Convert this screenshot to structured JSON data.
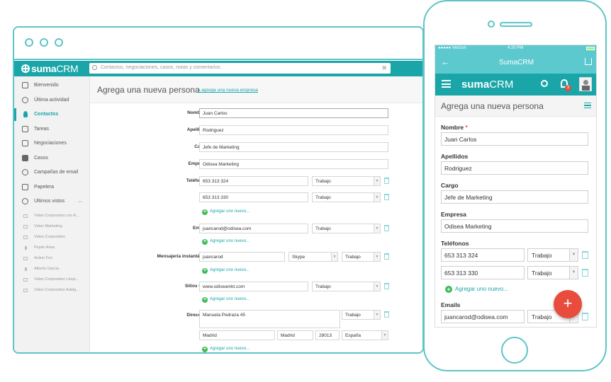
{
  "desktop": {
    "brand": {
      "name": "suma",
      "suffix": "CRM"
    },
    "search": {
      "placeholder": "Contactos, negociaciones, casos, notas y comentarios"
    },
    "sidebar": {
      "items": [
        {
          "label": "Bienvenido",
          "icon": "home-icon"
        },
        {
          "label": "Última actividad",
          "icon": "history-icon"
        },
        {
          "label": "Contactos",
          "icon": "person-icon",
          "active": true
        },
        {
          "label": "Tareas",
          "icon": "checkbox-icon"
        },
        {
          "label": "Negociaciones",
          "icon": "money-icon"
        },
        {
          "label": "Casos",
          "icon": "briefcase-icon"
        },
        {
          "label": "Campañas de email",
          "icon": "at-icon"
        },
        {
          "label": "Papelera",
          "icon": "trash-icon"
        },
        {
          "label": "Ultimos vistos",
          "icon": "clock-icon"
        }
      ],
      "recent": [
        "Video Corporativo con A...",
        "Video Marketing",
        "Video Corporativo",
        "Pepito Arias",
        "Action Fun",
        "Alberto Garcia",
        "Video Corporativo Limpi...",
        "Video Corporativo Adelg..."
      ]
    },
    "form": {
      "title": "Agrega una nueva persona",
      "alt_link": "o agrega una nueva empresa",
      "labels": {
        "nombre": "Nombre",
        "apellidos": "Apellidos",
        "cargo": "Cargo",
        "empresa": "Empresa",
        "telefonos": "Teléfonos",
        "emails": "Emails",
        "mensajeria": "Mensajería instantánea",
        "sitios": "Sitios web",
        "direccion": "Dirección"
      },
      "required_mark": "*",
      "values": {
        "nombre": "Juan Carlos",
        "apellidos": "Rodriguez",
        "cargo": "Jefe de Marketing",
        "empresa": "Odisea Marketing",
        "tel1": "653 313 324",
        "tel2": "653 313 330",
        "email": "juancarod@odisea.com",
        "im": "juancarod",
        "im_service": "Skype",
        "web": "www.odiseamkt.com",
        "street": "Manuela Pedraza 45",
        "city": "Madrid",
        "province": "Madrid",
        "zip": "28013",
        "country": "España"
      },
      "type_label": "Trabajo",
      "add_label": "Agregar uno nuevo..."
    }
  },
  "phone": {
    "status": {
      "carrier": "●●●●● Verizon",
      "time": "4:20 PM"
    },
    "nav_title": "SumaCRM",
    "brand": {
      "name": "suma",
      "suffix": "CRM"
    },
    "notification_count": "3",
    "form": {
      "title": "Agrega una nueva persona",
      "labels": {
        "nombre": "Nombre",
        "apellidos": "Apellidos",
        "cargo": "Cargo",
        "empresa": "Empresa",
        "telefonos": "Teléfonos",
        "emails": "Emails"
      },
      "required_mark": "*",
      "values": {
        "nombre": "Juan Carlos",
        "apellidos": "Rodriguez",
        "cargo": "Jefe de Marketing",
        "empresa": "Odisea Marketing",
        "tel1": "653 313 324",
        "tel2": "653 313 330",
        "email": "juancarod@odisea.com"
      },
      "type_label": "Trabajo",
      "add_label": "Agregar uno nuevo..."
    },
    "fab_label": "+"
  },
  "colors": {
    "accent": "#1aa6a8",
    "frame": "#5ec4c8",
    "fab": "#e74c3c",
    "add": "#3dbb5a"
  }
}
